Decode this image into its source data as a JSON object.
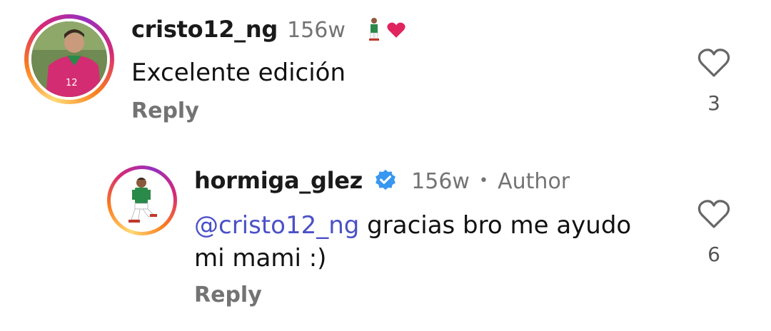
{
  "comments": [
    {
      "username": "cristo12_ng",
      "age": "156w",
      "text": "Excelente edición",
      "reply_label": "Reply",
      "like_count": "3",
      "jersey_number": "12"
    },
    {
      "username": "hormiga_glez",
      "age": "156w",
      "separator": "•",
      "author_badge": "Author",
      "mention": "@cristo12_ng",
      "text_line1": " gracias bro me ayudo",
      "text_line2": "mi mami :)",
      "reply_label": "Reply",
      "like_count": "6"
    }
  ],
  "colors": {
    "verified": "#3897f0",
    "heart": "#e0245e",
    "mention": "#4b51c7",
    "secondary_text": "#737373"
  }
}
